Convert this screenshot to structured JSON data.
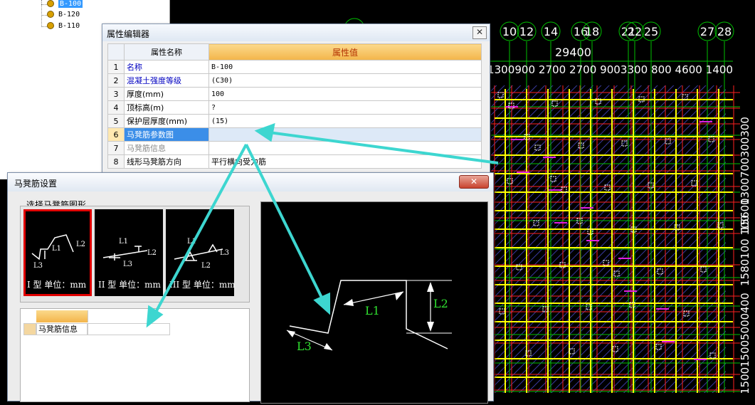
{
  "tree": {
    "items": [
      {
        "label": "B-100",
        "selected": true
      },
      {
        "label": "B-120",
        "selected": false
      },
      {
        "label": "B-110",
        "selected": false
      }
    ]
  },
  "cad": {
    "axis_top": [
      "10",
      "12",
      "14",
      "16",
      "18",
      "21",
      "22",
      "25",
      "27",
      "28"
    ],
    "dim_total": "29400",
    "dims_row": "1300900 2700 2700 9003300 800 4600 1400",
    "dims_right": [
      "700300300",
      "1300",
      "15600",
      "100 100",
      "1580",
      "400",
      "5000",
      "1500",
      "1500"
    ],
    "colors": {
      "grid": "#ff2020",
      "axis": "#00c000",
      "beam": "#ffff00",
      "accent": "#e020e0",
      "hatch": "#3a3aa0"
    }
  },
  "property_editor": {
    "title": "属性编辑器",
    "header": {
      "name": "属性名称",
      "value": "属性值"
    },
    "rows": [
      {
        "num": "1",
        "name": "名称",
        "value": "B-100",
        "style": "blue"
      },
      {
        "num": "2",
        "name": "混凝土强度等级",
        "value": "(C30)",
        "style": "blue"
      },
      {
        "num": "3",
        "name": "厚度(mm)",
        "value": "100",
        "style": ""
      },
      {
        "num": "4",
        "name": "顶标高(m)",
        "value": "?",
        "style": ""
      },
      {
        "num": "5",
        "name": "保护层厚度(mm)",
        "value": "(15)",
        "style": ""
      },
      {
        "num": "6",
        "name": "马凳筋参数图",
        "value": "",
        "style": "sel"
      },
      {
        "num": "7",
        "name": "马凳筋信息",
        "value": "",
        "style": "gray"
      },
      {
        "num": "8",
        "name": "线形马凳筋方向",
        "value": "平行横向受力筋",
        "style": ""
      }
    ],
    "close_icon": "close-icon"
  },
  "stool_dialog": {
    "title": "马凳筋设置",
    "group_label": "选择马凳筋图形",
    "shapes": [
      {
        "caption": "I 型  单位：mm",
        "selected": true
      },
      {
        "caption": "II 型  单位：mm",
        "selected": false
      },
      {
        "caption": "III 型  单位：mm",
        "selected": false
      }
    ],
    "shape_labels": {
      "l1": "L1",
      "l2": "L2",
      "l3": "L3"
    },
    "info_row_label": "马凳筋信息",
    "preview_labels": {
      "l1": "L1",
      "l2": "L2",
      "l3": "L3"
    },
    "close_label": "✕"
  },
  "annotation_arrow_color": "#3dd6d0"
}
